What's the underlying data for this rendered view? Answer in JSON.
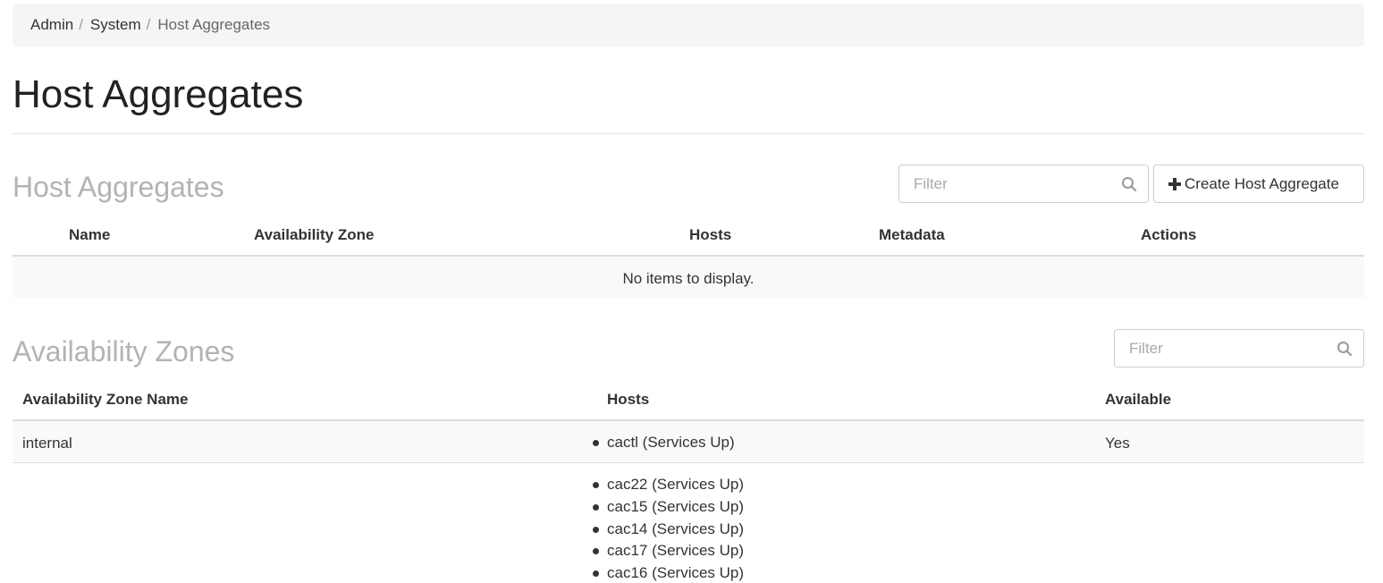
{
  "breadcrumb": {
    "items": [
      "Admin",
      "System"
    ],
    "separator": "/",
    "current": "Host Aggregates"
  },
  "page_title": "Host Aggregates",
  "host_aggregates": {
    "title": "Host Aggregates",
    "filter_placeholder": "Filter",
    "create_button_label": "Create Host Aggregate",
    "columns": [
      "Name",
      "Availability Zone",
      "Hosts",
      "Metadata",
      "Actions"
    ],
    "empty_message": "No items to display."
  },
  "availability_zones": {
    "title": "Availability Zones",
    "filter_placeholder": "Filter",
    "columns": [
      "Availability Zone Name",
      "Hosts",
      "Available"
    ],
    "rows": [
      {
        "name": "internal",
        "hosts": [
          "cactl (Services Up)"
        ],
        "available": "Yes"
      },
      {
        "name": "",
        "hosts": [
          "cac22 (Services Up)",
          "cac15 (Services Up)",
          "cac14 (Services Up)",
          "cac17 (Services Up)",
          "cac16 (Services Up)"
        ],
        "available": ""
      }
    ]
  },
  "icons": {
    "filter": "search-icon",
    "create": "plus-icon",
    "host_bullet": "bullet"
  },
  "colors": {
    "breadcrumb_bg": "#f5f5f5",
    "section_title": "#b3b3b3",
    "row_stripe": "#f9f9f9",
    "border": "#dddddd"
  }
}
